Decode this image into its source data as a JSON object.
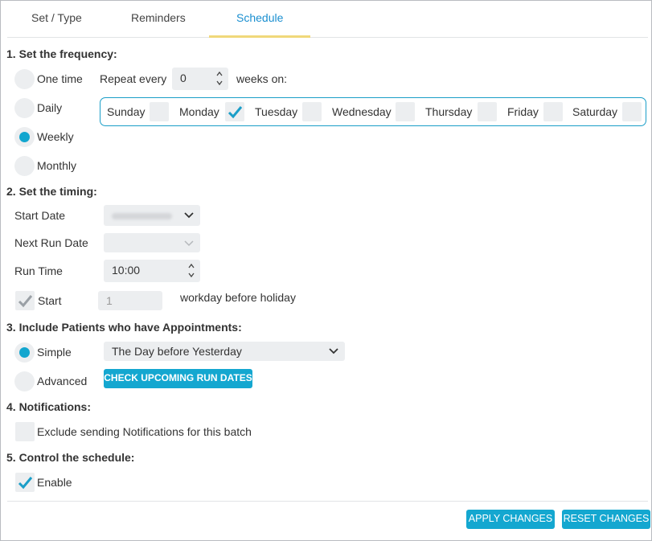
{
  "tabs": {
    "set_type": "Set / Type",
    "reminders": "Reminders",
    "schedule": "Schedule"
  },
  "frequency": {
    "heading": "1. Set the frequency:",
    "options": {
      "one_time": "One time",
      "daily": "Daily",
      "weekly": "Weekly",
      "monthly": "Monthly"
    },
    "selected": "Weekly",
    "repeat_label": "Repeat every",
    "repeat_value": "0",
    "weeks_on": "weeks on:",
    "days": {
      "sunday": "Sunday",
      "monday": "Monday",
      "tuesday": "Tuesday",
      "wednesday": "Wednesday",
      "thursday": "Thursday",
      "friday": "Friday",
      "saturday": "Saturday"
    },
    "checked_days": [
      "Monday"
    ]
  },
  "timing": {
    "heading": "2. Set the timing:",
    "start_date_label": "Start Date",
    "next_run_label": "Next Run Date",
    "run_time_label": "Run Time",
    "run_time_value": "10:00",
    "start_label": "Start",
    "start_value": "1",
    "workday_text": "workday before holiday"
  },
  "patients": {
    "heading": "3. Include Patients who have Appointments:",
    "simple_label": "Simple",
    "advanced_label": "Advanced",
    "selected": "Simple",
    "simple_value": "The Day before Yesterday",
    "check_dates_button": "CHECK UPCOMING RUN DATES"
  },
  "notifications": {
    "heading": "4. Notifications:",
    "exclude_label": "Exclude sending Notifications for this batch"
  },
  "control": {
    "heading": "5. Control the schedule:",
    "enable_label": "Enable"
  },
  "footer": {
    "apply": "APPLY CHANGES",
    "reset": "RESET CHANGES"
  },
  "colors": {
    "accent": "#14a7d0",
    "tab_underline": "#f0d87a",
    "field_bg": "#eceef0",
    "tab_active": "#1a8fd0"
  }
}
